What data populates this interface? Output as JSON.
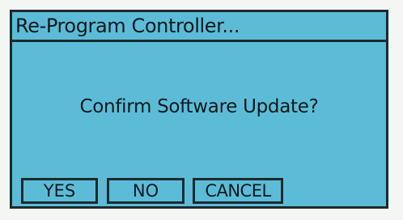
{
  "dialog": {
    "title": "Re-Program Controller...",
    "message": "Confirm Software Update?"
  },
  "softkeys": {
    "yes_label": "YES",
    "no_label": "NO",
    "cancel_label": "CANCEL"
  },
  "colors": {
    "lcd_background": "#5cbcd8",
    "text_and_borders": "#1c2a2e"
  }
}
